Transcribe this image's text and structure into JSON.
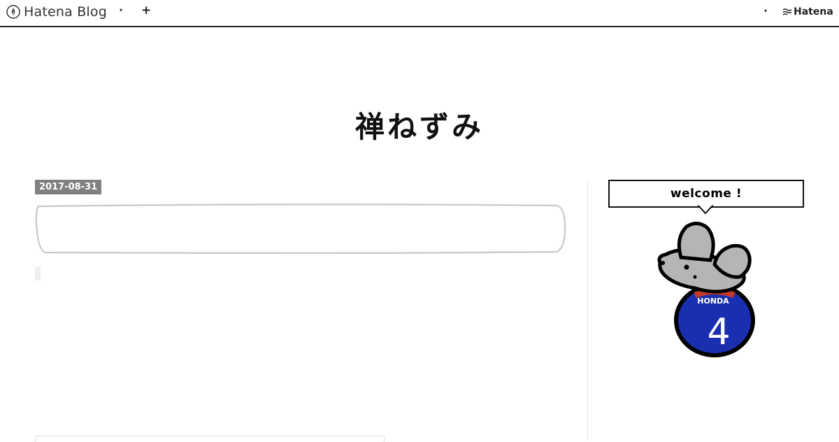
{
  "header": {
    "logo_text": "Hatena Blog",
    "menu_caret": "▾",
    "add_symbol": "+",
    "user_caret": "▾",
    "hatena_text": "Hatena"
  },
  "blog": {
    "title": "禅ねずみ"
  },
  "entry": {
    "date": "2017-08-31",
    "title": ""
  },
  "sidebar": {
    "welcome_text": "welcome !",
    "mascot": {
      "shirt_name": "HONDA",
      "shirt_number": "4",
      "colors": {
        "body": "#b5b5b5",
        "jersey": "#1a2fb0",
        "collar": "#c0392b",
        "outline": "#000000"
      }
    }
  }
}
